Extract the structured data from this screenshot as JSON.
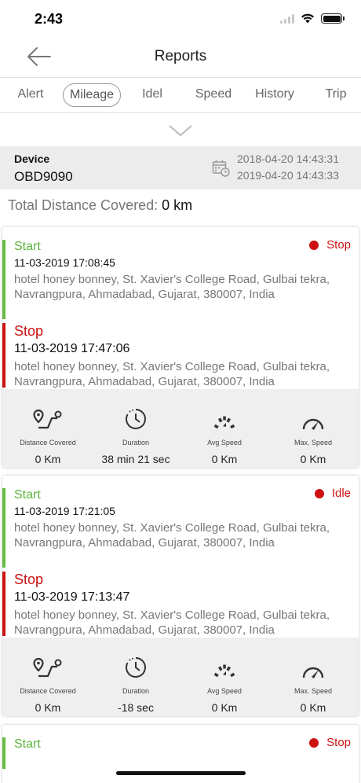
{
  "status_bar": {
    "time": "2:43"
  },
  "nav": {
    "title": "Reports"
  },
  "tabs": [
    {
      "label": "Alert",
      "active": false
    },
    {
      "label": "Mileage",
      "active": true
    },
    {
      "label": "Idel",
      "active": false
    },
    {
      "label": "Speed",
      "active": false
    },
    {
      "label": "History",
      "active": false
    },
    {
      "label": "Trip",
      "active": false
    }
  ],
  "device": {
    "label": "Device",
    "value": "OBD9090",
    "date_from": "2018-04-20 14:43:31",
    "date_to": "2019-04-20 14:43:33"
  },
  "total": {
    "label": "Total Distance Covered:",
    "value": "0 km"
  },
  "stat_labels": {
    "distance": "Distance Covered",
    "duration": "Duration",
    "avg": "Avg Speed",
    "max": "Max. Speed"
  },
  "cards": [
    {
      "state": "Stop",
      "start": {
        "title": "Start",
        "time": "11-03-2019 17:08:45",
        "address": "hotel honey bonney, St. Xavier's College Road, Gulbai tekra, Navrangpura, Ahmadabad, Gujarat, 380007, India"
      },
      "stop": {
        "title": "Stop",
        "time": "11-03-2019 17:47:06",
        "address": "hotel honey bonney, St. Xavier's College Road, Gulbai tekra, Navrangpura, Ahmadabad, Gujarat, 380007, India"
      },
      "stats": {
        "distance": "0 Km",
        "duration": "38 min 21 sec",
        "avg": "0 Km",
        "max": "0 Km"
      }
    },
    {
      "state": "Idle",
      "start": {
        "title": "Start",
        "time": "11-03-2019 17:21:05",
        "address": "hotel honey bonney, St. Xavier's College Road, Gulbai tekra, Navrangpura, Ahmadabad, Gujarat, 380007, India"
      },
      "stop": {
        "title": "Stop",
        "time": "11-03-2019 17:13:47",
        "address": "hotel honey bonney, St. Xavier's College Road, Gulbai tekra, Navrangpura, Ahmadabad, Gujarat, 380007, India"
      },
      "stats": {
        "distance": "0 Km",
        "duration": "-18 sec",
        "avg": "0 Km",
        "max": "0 Km"
      }
    },
    {
      "state": "Stop",
      "start": {
        "title": "Start"
      }
    }
  ],
  "colors": {
    "start": "#5bb33c",
    "stop": "#cc1111",
    "stats_bg": "#efefef"
  }
}
